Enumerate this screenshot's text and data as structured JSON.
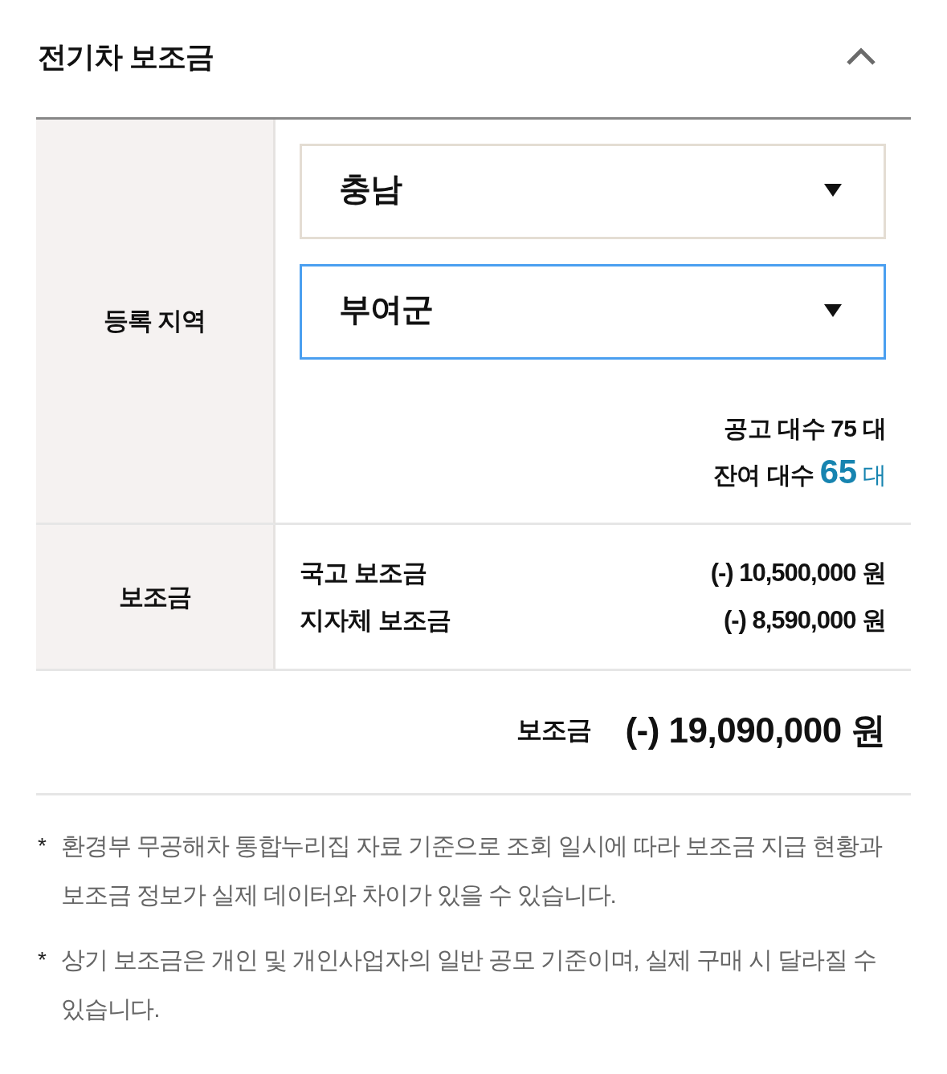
{
  "section": {
    "title": "전기차 보조금",
    "expanded": true
  },
  "region": {
    "label": "등록 지역",
    "selects": [
      {
        "value": "충남",
        "focused": false
      },
      {
        "value": "부여군",
        "focused": true
      }
    ],
    "counts": [
      {
        "label": "공고 대수",
        "count": "75",
        "unit": "대",
        "highlighted": false
      },
      {
        "label": "잔여 대수",
        "count": "65",
        "unit": "대",
        "highlighted": true
      }
    ]
  },
  "subsidy": {
    "label": "보조금",
    "items": [
      {
        "name": "국고 보조금",
        "amount": "(-) 10,500,000 원"
      },
      {
        "name": "지자체 보조금",
        "amount": "(-) 8,590,000 원"
      }
    ]
  },
  "total": {
    "label": "보조금",
    "amount": "(-) 19,090,000 원"
  },
  "notes": [
    {
      "mark": "*",
      "text": "환경부 무공해차 통합누리집 자료 기준으로 조회 일시에 따라 보조금 지급 현황과 보조금 정보가 실제 데이터와 차이가 있을 수 있습니다."
    },
    {
      "mark": "*",
      "text": "상기 보조금은 개인 및 개인사업자의 일반 공모 기준이며, 실제 구매 시 달라질 수 있습니다."
    }
  ]
}
